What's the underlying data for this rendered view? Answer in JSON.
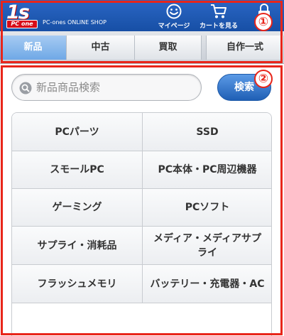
{
  "header": {
    "logo_text": "1s",
    "logo_plate_text": "PC one",
    "shop_name": "PC-ones ONLINE SHOP",
    "mypage_label": "マイページ",
    "cart_label": "カートを見る"
  },
  "tabs": [
    {
      "label": "新品",
      "active": true
    },
    {
      "label": "中古",
      "active": false
    },
    {
      "label": "買取",
      "active": false
    },
    {
      "label": "自作一式",
      "active": false
    }
  ],
  "search": {
    "placeholder": "新品商品検索",
    "button_label": "検索"
  },
  "categories": [
    "PCパーツ",
    "SSD",
    "スモールPC",
    "PC本体・PC周辺機器",
    "ゲーミング",
    "PCソフト",
    "サプライ・消耗品",
    "メディア・メディアサプライ",
    "フラッシュメモリ",
    "バッテリー・充電器・AC"
  ],
  "annotations": [
    "①",
    "②"
  ],
  "colors": {
    "header_blue": "#1f5bb3",
    "active_tab": "#7fb2ea",
    "annotation_red": "#e8251a"
  }
}
